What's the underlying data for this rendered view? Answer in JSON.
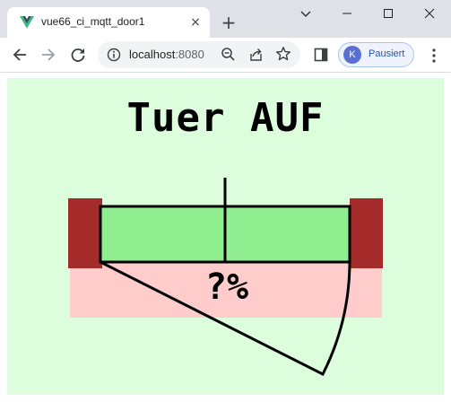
{
  "browser": {
    "tab_title": "vue66_ci_mqtt_door1",
    "tab_close_glyph": "×",
    "new_tab_glyph": "+",
    "url_host": "localhost",
    "url_port": ":8080",
    "profile_initial": "K",
    "profile_label": "Pausiert",
    "icons": [
      "vue-favicon-icon",
      "back-arrow-icon",
      "forward-arrow-icon",
      "reload-icon",
      "info-icon",
      "zoom-icon",
      "share-icon",
      "star-icon",
      "side-panel-icon",
      "menu-dots-icon",
      "minimize-icon",
      "maximize-icon",
      "close-icon",
      "chevron-down-icon"
    ]
  },
  "door": {
    "title": "Tuer AUF",
    "percent_text": "?%",
    "colors": {
      "page_background": "#ddfedd",
      "frame": "#a52a2a",
      "door_panel": "#90ee90",
      "open_zone": "#ffcccc"
    }
  }
}
